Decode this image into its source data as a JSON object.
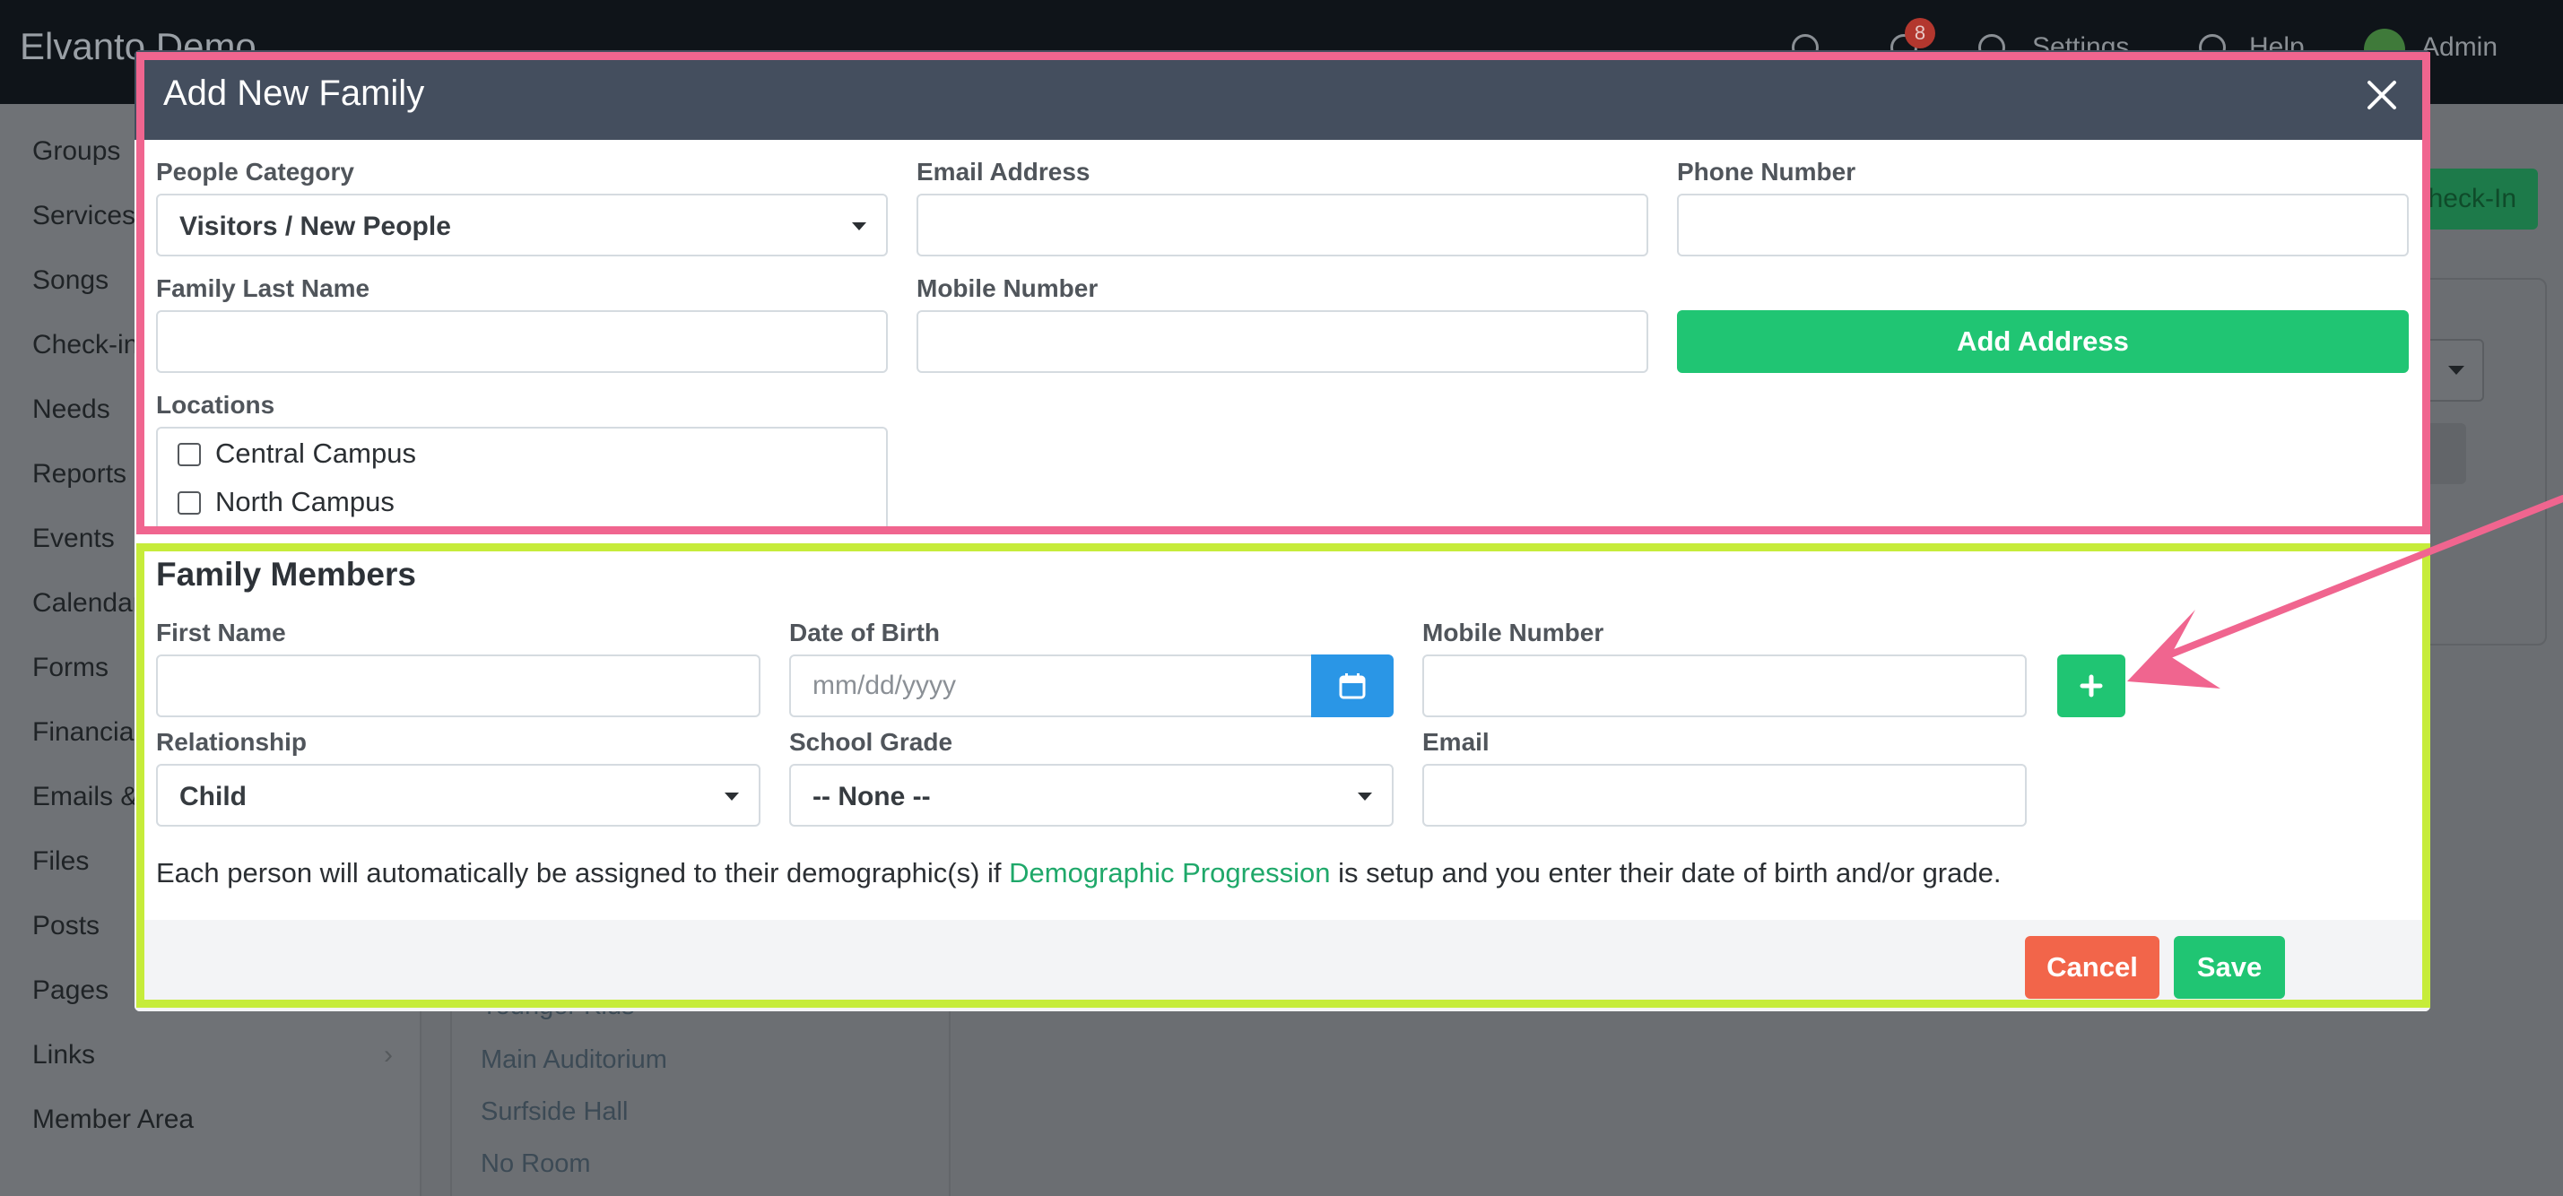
{
  "app": {
    "brand": "Elvanto Demo",
    "notification_count": "8",
    "settings_label": "Settings",
    "help_label": "Help",
    "admin_label": "Admin",
    "checkin_button": "Check-In",
    "sidebar": [
      {
        "label": "Groups"
      },
      {
        "label": "Services"
      },
      {
        "label": "Songs"
      },
      {
        "label": "Check-in"
      },
      {
        "label": "Needs"
      },
      {
        "label": "Reports"
      },
      {
        "label": "Events"
      },
      {
        "label": "Calendar"
      },
      {
        "label": "Forms"
      },
      {
        "label": "Financial"
      },
      {
        "label": "Emails &"
      },
      {
        "label": "Files"
      },
      {
        "label": "Posts"
      },
      {
        "label": "Pages"
      },
      {
        "label": "Links"
      },
      {
        "label": "Member Area"
      }
    ],
    "rooms": [
      {
        "label": "Younger Kids"
      },
      {
        "label": "Main Auditorium"
      },
      {
        "label": "Surfside Hall"
      },
      {
        "label": "No Room"
      }
    ]
  },
  "modal": {
    "title": "Add New Family",
    "people_category": {
      "label": "People Category",
      "value": "Visitors / New People"
    },
    "email_address": {
      "label": "Email Address",
      "value": ""
    },
    "phone_number": {
      "label": "Phone Number",
      "value": ""
    },
    "family_last_name": {
      "label": "Family Last Name",
      "value": ""
    },
    "mobile_number": {
      "label": "Mobile Number",
      "value": ""
    },
    "add_address_button": "Add Address",
    "locations": {
      "label": "Locations",
      "options": [
        {
          "label": "Central Campus",
          "checked": false
        },
        {
          "label": "North Campus",
          "checked": false
        }
      ]
    },
    "family_members": {
      "title": "Family Members",
      "first_name": {
        "label": "First Name",
        "value": ""
      },
      "date_of_birth": {
        "label": "Date of Birth",
        "placeholder": "mm/dd/yyyy",
        "value": ""
      },
      "mobile_number": {
        "label": "Mobile Number",
        "value": ""
      },
      "relationship": {
        "label": "Relationship",
        "value": "Child"
      },
      "school_grade": {
        "label": "School Grade",
        "value": "-- None --"
      },
      "email": {
        "label": "Email",
        "value": ""
      }
    },
    "help_text": {
      "before": "Each person will automatically be assigned to their demographic(s) if ",
      "link": "Demographic Progression",
      "after": " is setup and you enter their date of birth and/or grade."
    },
    "cancel_button": "Cancel",
    "save_button": "Save"
  },
  "colors": {
    "modal_header": "#444e5e",
    "primary_green": "#20c573",
    "cancel_red": "#f2654a",
    "date_blue": "#2a96e6",
    "highlight_pink": "#f0658f",
    "highlight_lime": "#c6ec3a"
  }
}
